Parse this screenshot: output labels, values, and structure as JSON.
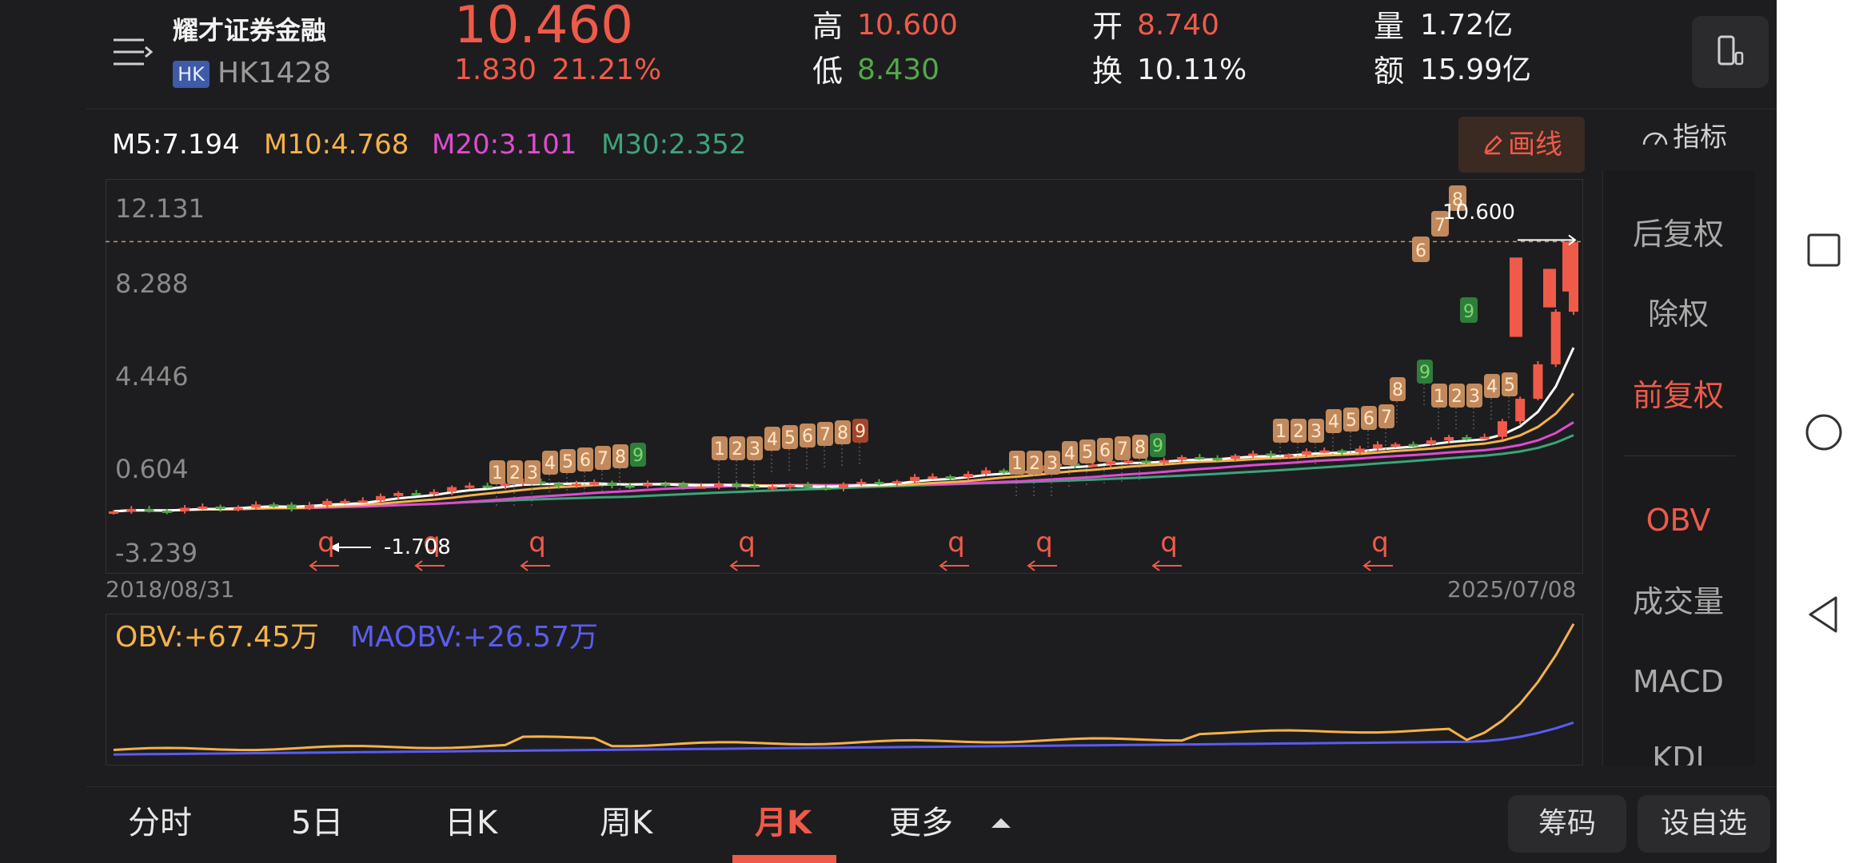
{
  "header": {
    "stock_name": "耀才证券金融",
    "market_badge": "HK",
    "code": "HK1428",
    "price": "10.460",
    "change": "1.830",
    "change_pct": "21.21%",
    "high_label": "高",
    "high": "10.600",
    "low_label": "低",
    "low": "8.430",
    "open_label": "开",
    "open": "8.740",
    "turnover_label": "换",
    "turnover": "10.11%",
    "volume_label": "量",
    "volume": "1.72亿",
    "amount_label": "额",
    "amount": "15.99亿"
  },
  "ma": {
    "m5": "M5:7.194",
    "m10": "M10:4.768",
    "m20": "M20:3.101",
    "m30": "M30:2.352",
    "draw_button": "画线",
    "indicator_label": "指标"
  },
  "chart": {
    "y_ticks": [
      "12.131",
      "8.288",
      "4.446",
      "0.604",
      "-3.239"
    ],
    "start_date": "2018/08/31",
    "end_date": "2025/07/08",
    "max_label": "10.600",
    "min_label": "-1.708",
    "obv_label": "OBV:+67.45万",
    "maobv_label": "MAOBV:+26.57万",
    "signal_char": "q"
  },
  "side_menu": [
    "后复权",
    "除权",
    "前复权",
    "OBV",
    "成交量",
    "MACD",
    "KDJ"
  ],
  "bottom_tabs": [
    "分时",
    "5日",
    "日K",
    "周K",
    "月K",
    "更多"
  ],
  "bottom_buttons": {
    "chips": "筹码",
    "watchlist": "设自选"
  },
  "colors": {
    "background": "#1d1d1f",
    "up": "#ef5a49",
    "down": "#53a84a",
    "m5": "#ffffff",
    "m10": "#f5b24a",
    "m20": "#e04bd0",
    "m30": "#3ea37a",
    "obv": "#f5b24a",
    "maobv": "#5a5cf0",
    "td_orange": "#c28a5c",
    "td_green": "#2f7d3b"
  },
  "chart_data": {
    "type": "candlestick",
    "period": "monthly",
    "ylim": [
      -3.239,
      12.131
    ],
    "last_close": 10.46,
    "high": 10.6,
    "ma_values": {
      "M5": 7.194,
      "M10": 4.768,
      "M20": 3.101,
      "M30": 2.352
    },
    "obv_last": "+67.45万",
    "maobv_last": "+26.57万"
  }
}
